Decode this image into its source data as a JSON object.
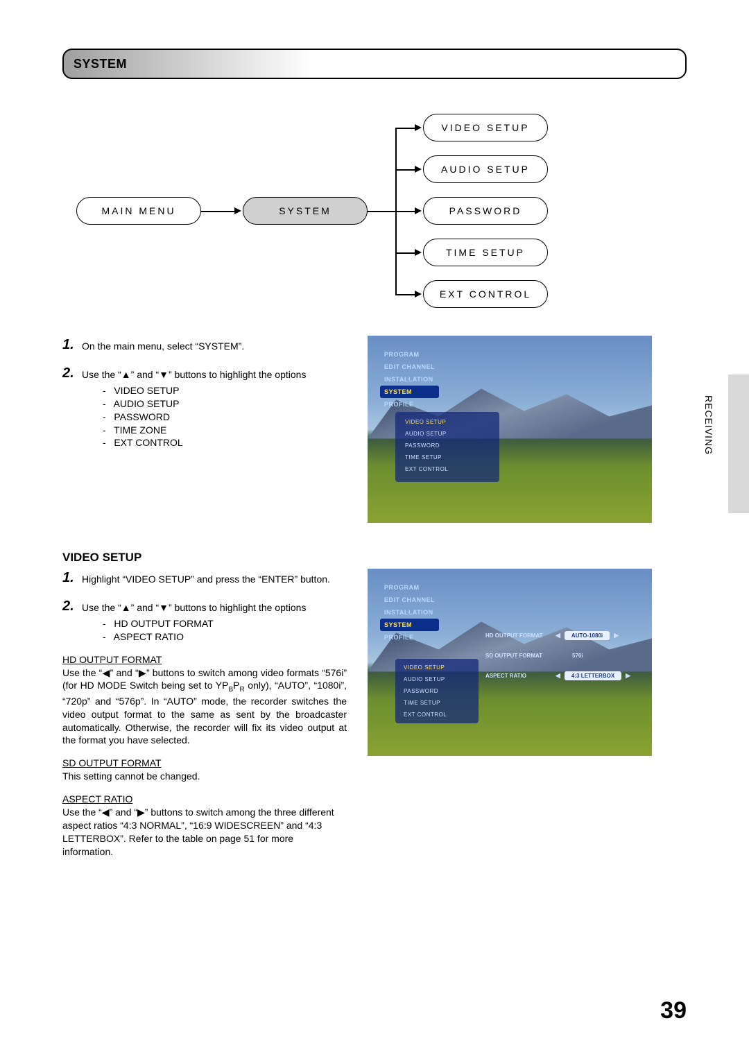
{
  "header": {
    "title": "SYSTEM"
  },
  "diagram": {
    "main_menu": "MAIN MENU",
    "system": "SYSTEM",
    "items": [
      "VIDEO SETUP",
      "AUDIO SETUP",
      "PASSWORD",
      "TIME SETUP",
      "EXT CONTROL"
    ]
  },
  "section1": {
    "step1": "On the main menu, select “SYSTEM”.",
    "step2_lead": "Use the “▲” and “▼” buttons to highlight the options",
    "step2_opts": [
      "VIDEO SETUP",
      "AUDIO SETUP",
      "PASSWORD",
      "TIME ZONE",
      "EXT CONTROL"
    ]
  },
  "menu1": {
    "items": [
      "PROGRAM",
      "EDIT CHANNEL",
      "INSTALLATION",
      "SYSTEM",
      "PROFILE"
    ],
    "highlight": "SYSTEM",
    "sub": [
      "VIDEO SETUP",
      "AUDIO SETUP",
      "PASSWORD",
      "TIME SETUP",
      "EXT CONTROL"
    ],
    "sub_highlight": "VIDEO SETUP"
  },
  "video_setup_heading": "VIDEO SETUP",
  "section2": {
    "step1": "Highlight “VIDEO SETUP” and press the “ENTER” button.",
    "step2_lead": "Use the “▲” and “▼” buttons to highlight the options",
    "step2_opts": [
      "HD OUTPUT FORMAT",
      "ASPECT RATIO"
    ],
    "hd_label": "HD OUTPUT FORMAT",
    "hd_body_1": "Use the “◀” and “▶” buttons to switch among video formats “576i” (for HD MODE Switch being set to YP",
    "hd_body_sub1": "B",
    "hd_body_mid": "P",
    "hd_body_sub2": "R",
    "hd_body_2": " only), “AUTO”, “1080i”, “720p” and “576p”. In “AUTO” mode, the recorder switches the video output format to the same as sent by the broadcaster automatically. Otherwise, the recorder will fix its video output at the format you have selected.",
    "sd_label": "SD OUTPUT FORMAT",
    "sd_body": "This setting cannot be changed.",
    "ar_label": "ASPECT RATIO",
    "ar_body": "Use the “◀” and “▶” buttons to switch among the three different aspect ratios “4:3 NORMAL”, “16:9 WIDESCREEN” and “4:3 LETTERBOX”. Refer to the table on page 51 for more information."
  },
  "menu2": {
    "right_rows": [
      {
        "label": "HD OUTPUT FORMAT",
        "value": "AUTO-1080i",
        "arrows": true
      },
      {
        "label": "SD OUTPUT FORMAT",
        "value": "576i",
        "arrows": false
      },
      {
        "label": "ASPECT RATIO",
        "value": "4:3 LETTERBOX",
        "arrows": true
      }
    ]
  },
  "side_label": "RECEIVING",
  "page_number": "39"
}
